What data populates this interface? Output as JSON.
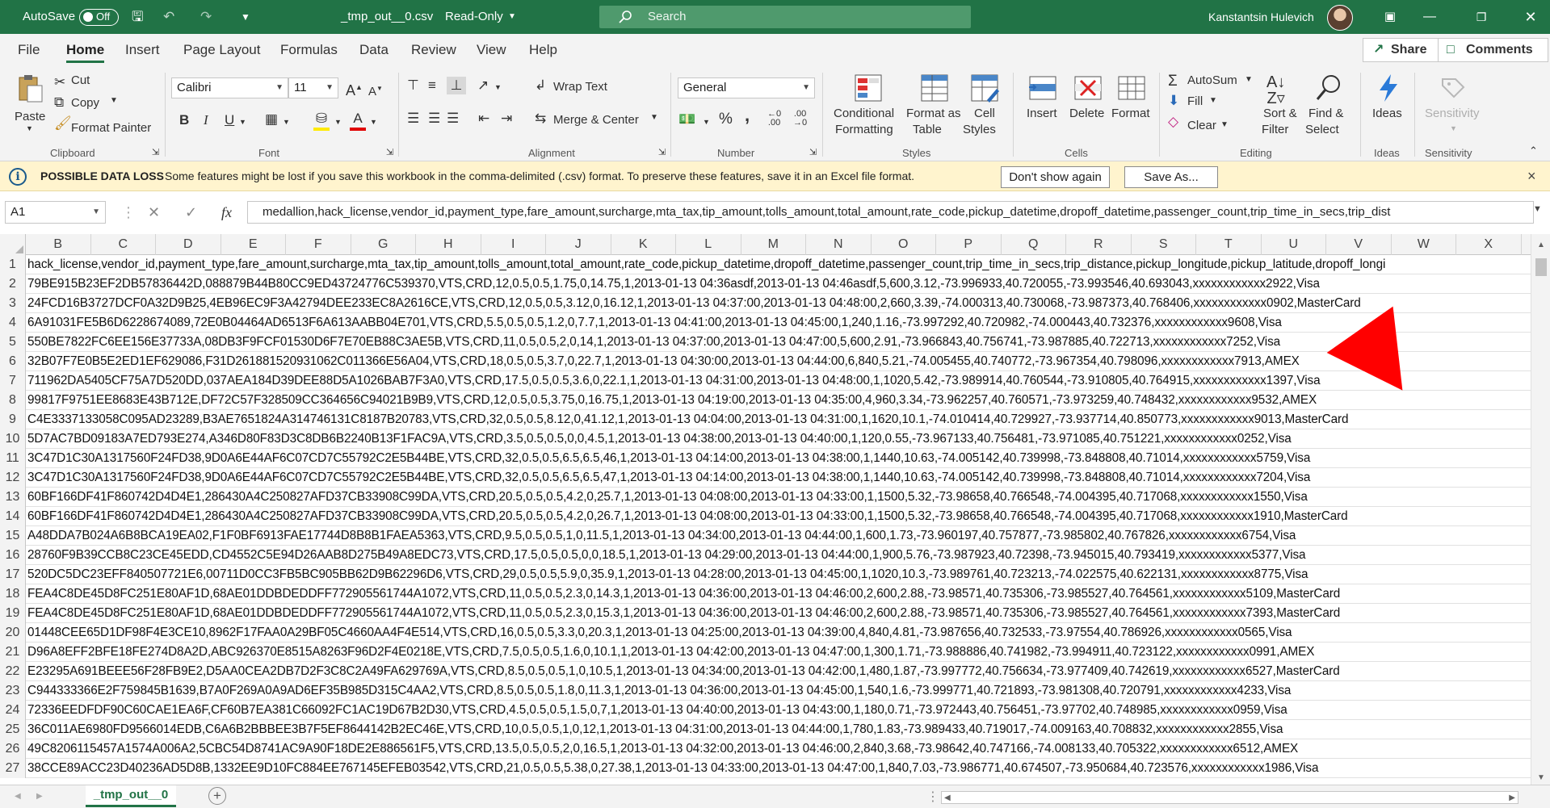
{
  "titlebar": {
    "autosave_label": "AutoSave",
    "autosave_state": "Off",
    "filename": "_tmp_out__0.csv",
    "mode": "Read-Only",
    "search_placeholder": "Search",
    "user_name": "Kanstantsin Hulevich",
    "accent": "#217346"
  },
  "tabs": [
    "File",
    "Home",
    "Insert",
    "Page Layout",
    "Formulas",
    "Data",
    "Review",
    "View",
    "Help"
  ],
  "active_tab": "Home",
  "share_label": "Share",
  "comments_label": "Comments",
  "ribbon": {
    "clipboard": {
      "paste": "Paste",
      "cut": "Cut",
      "copy": "Copy",
      "format_painter": "Format Painter",
      "group": "Clipboard"
    },
    "font": {
      "name": "Calibri",
      "size": "11",
      "group": "Font",
      "bold": "B",
      "italic": "I",
      "underline": "U"
    },
    "alignment": {
      "wrap": "Wrap Text",
      "merge": "Merge & Center",
      "group": "Alignment"
    },
    "number": {
      "format": "General",
      "percent": "%",
      "comma": ",",
      "group": "Number"
    },
    "styles": {
      "conditional": [
        "Conditional",
        "Formatting"
      ],
      "format_table": [
        "Format as",
        "Table"
      ],
      "cell_styles": [
        "Cell",
        "Styles"
      ],
      "group": "Styles"
    },
    "cells": {
      "insert": "Insert",
      "delete": "Delete",
      "format": "Format",
      "group": "Cells"
    },
    "editing": {
      "autosum": "AutoSum",
      "fill": "Fill",
      "clear": "Clear",
      "sort": [
        "Sort &",
        "Filter"
      ],
      "find": [
        "Find &",
        "Select"
      ],
      "group": "Editing"
    },
    "ideas": {
      "label": "Ideas",
      "group": "Ideas"
    },
    "sensitivity": {
      "label": "Sensitivity",
      "group": "Sensitivity"
    }
  },
  "infobar": {
    "title": "POSSIBLE DATA LOSS",
    "message": "Some features might be lost if you save this workbook in the comma-delimited (.csv) format. To preserve these features, save it in an Excel file format.",
    "dont_show": "Don't show again",
    "save_as": "Save As...",
    "close": "×"
  },
  "formula_bar": {
    "name_box": "A1",
    "fx": "fx",
    "content": "medallion,hack_license,vendor_id,payment_type,fare_amount,surcharge,mta_tax,tip_amount,tolls_amount,total_amount,rate_code,pickup_datetime,dropoff_datetime,passenger_count,trip_time_in_secs,trip_dist"
  },
  "columns": [
    "B",
    "C",
    "D",
    "E",
    "F",
    "G",
    "H",
    "I",
    "J",
    "K",
    "L",
    "M",
    "N",
    "O",
    "P",
    "Q",
    "R",
    "S",
    "T",
    "U",
    "V",
    "W",
    "X"
  ],
  "rows": [
    {
      "n": "1",
      "text": "hack_license,vendor_id,payment_type,fare_amount,surcharge,mta_tax,tip_amount,tolls_amount,total_amount,rate_code,pickup_datetime,dropoff_datetime,passenger_count,trip_time_in_secs,trip_distance,pickup_longitude,pickup_latitude,dropoff_longi"
    },
    {
      "n": "2",
      "text": "79BE915B23EF2DB57836442D,088879B44B80CC9ED43724776C539370,VTS,CRD,12,0.5,0.5,1.75,0,14.75,1,2013-01-13 04:36asdf,2013-01-13 04:46asdf,5,600,3.12,-73.996933,40.720055,-73.993546,40.693043,xxxxxxxxxxxx2922,Visa"
    },
    {
      "n": "3",
      "text": "24FCD16B3727DCF0A32D9B25,4EB96EC9F3A42794DEE233EC8A2616CE,VTS,CRD,12,0.5,0.5,3.12,0,16.12,1,2013-01-13 04:37:00,2013-01-13 04:48:00,2,660,3.39,-74.000313,40.730068,-73.987373,40.768406,xxxxxxxxxxxx0902,MasterCard"
    },
    {
      "n": "4",
      "text": "6A91031FE5B6D6228674089,72E0B04464AD6513F6A613AABB04E701,VTS,CRD,5.5,0.5,0.5,1.2,0,7.7,1,2013-01-13 04:41:00,2013-01-13 04:45:00,1,240,1.16,-73.997292,40.720982,-74.000443,40.732376,xxxxxxxxxxxx9608,Visa"
    },
    {
      "n": "5",
      "text": "550BE7822FC6EE156E37733A,08DB3F9FCF01530D6F7E70EB88C3AE5B,VTS,CRD,11,0.5,0.5,2,0,14,1,2013-01-13 04:37:00,2013-01-13 04:47:00,5,600,2.91,-73.966843,40.756741,-73.987885,40.722713,xxxxxxxxxxxx7252,Visa"
    },
    {
      "n": "6",
      "text": "32B07F7E0B5E2ED1EF629086,F31D261881520931062C011366E56A04,VTS,CRD,18,0.5,0.5,3.7,0,22.7,1,2013-01-13 04:30:00,2013-01-13 04:44:00,6,840,5.21,-74.005455,40.740772,-73.967354,40.798096,xxxxxxxxxxxx7913,AMEX"
    },
    {
      "n": "7",
      "text": "711962DA5405CF75A7D520DD,037AEA184D39DEE88D5A1026BAB7F3A0,VTS,CRD,17.5,0.5,0.5,3.6,0,22.1,1,2013-01-13 04:31:00,2013-01-13 04:48:00,1,1020,5.42,-73.989914,40.760544,-73.910805,40.764915,xxxxxxxxxxxx1397,Visa"
    },
    {
      "n": "8",
      "text": "99817F9751EE8683E43B712E,DF72C57F328509CC364656C94021B9B9,VTS,CRD,12,0.5,0.5,3.75,0,16.75,1,2013-01-13 04:19:00,2013-01-13 04:35:00,4,960,3.34,-73.962257,40.760571,-73.973259,40.748432,xxxxxxxxxxxx9532,AMEX"
    },
    {
      "n": "9",
      "text": "C4E3337133058C095AD23289,B3AE7651824A314746131C8187B20783,VTS,CRD,32,0.5,0.5,8.12,0,41.12,1,2013-01-13 04:04:00,2013-01-13 04:31:00,1,1620,10.1,-74.010414,40.729927,-73.937714,40.850773,xxxxxxxxxxxx9013,MasterCard"
    },
    {
      "n": "10",
      "text": "5D7AC7BD09183A7ED793E274,A346D80F83D3C8DB6B2240B13F1FAC9A,VTS,CRD,3.5,0.5,0.5,0,0,4.5,1,2013-01-13 04:38:00,2013-01-13 04:40:00,1,120,0.55,-73.967133,40.756481,-73.971085,40.751221,xxxxxxxxxxxx0252,Visa"
    },
    {
      "n": "11",
      "text": "3C47D1C30A1317560F24FD38,9D0A6E44AF6C07CD7C55792C2E5B44BE,VTS,CRD,32,0.5,0.5,6.5,6.5,46,1,2013-01-13 04:14:00,2013-01-13 04:38:00,1,1440,10.63,-74.005142,40.739998,-73.848808,40.71014,xxxxxxxxxxxx5759,Visa"
    },
    {
      "n": "12",
      "text": "3C47D1C30A1317560F24FD38,9D0A6E44AF6C07CD7C55792C2E5B44BE,VTS,CRD,32,0.5,0.5,6.5,6.5,47,1,2013-01-13 04:14:00,2013-01-13 04:38:00,1,1440,10.63,-74.005142,40.739998,-73.848808,40.71014,xxxxxxxxxxxx7204,Visa"
    },
    {
      "n": "13",
      "text": "60BF166DF41F860742D4D4E1,286430A4C250827AFD37CB33908C99DA,VTS,CRD,20.5,0.5,0.5,4.2,0,25.7,1,2013-01-13 04:08:00,2013-01-13 04:33:00,1,1500,5.32,-73.98658,40.766548,-74.004395,40.717068,xxxxxxxxxxxx1550,Visa"
    },
    {
      "n": "14",
      "text": "60BF166DF41F860742D4D4E1,286430A4C250827AFD37CB33908C99DA,VTS,CRD,20.5,0.5,0.5,4.2,0,26.7,1,2013-01-13 04:08:00,2013-01-13 04:33:00,1,1500,5.32,-73.98658,40.766548,-74.004395,40.717068,xxxxxxxxxxxx1910,MasterCard"
    },
    {
      "n": "15",
      "text": "A48DDA7B024A6B8BCA19EA02,F1F0BF6913FAE17744D8B8B1FAEA5363,VTS,CRD,9.5,0.5,0.5,1,0,11.5,1,2013-01-13 04:34:00,2013-01-13 04:44:00,1,600,1.73,-73.960197,40.757877,-73.985802,40.767826,xxxxxxxxxxxx6754,Visa"
    },
    {
      "n": "16",
      "text": "28760F9B39CCB8C23CE45EDD,CD4552C5E94D26AAB8D275B49A8EDC73,VTS,CRD,17.5,0.5,0.5,0,0,18.5,1,2013-01-13 04:29:00,2013-01-13 04:44:00,1,900,5.76,-73.987923,40.72398,-73.945015,40.793419,xxxxxxxxxxxx5377,Visa"
    },
    {
      "n": "17",
      "text": "520DC5DC23EFF840507721E6,00711D0CC3FB5BC905BB62D9B62296D6,VTS,CRD,29,0.5,0.5,5.9,0,35.9,1,2013-01-13 04:28:00,2013-01-13 04:45:00,1,1020,10.3,-73.989761,40.723213,-74.022575,40.622131,xxxxxxxxxxxx8775,Visa"
    },
    {
      "n": "18",
      "text": "FEA4C8DE45D8FC251E80AF1D,68AE01DDBDEDDFF772905561744A1072,VTS,CRD,11,0.5,0.5,2.3,0,14.3,1,2013-01-13 04:36:00,2013-01-13 04:46:00,2,600,2.88,-73.98571,40.735306,-73.985527,40.764561,xxxxxxxxxxxx5109,MasterCard"
    },
    {
      "n": "19",
      "text": "FEA4C8DE45D8FC251E80AF1D,68AE01DDBDEDDFF772905561744A1072,VTS,CRD,11,0.5,0.5,2.3,0,15.3,1,2013-01-13 04:36:00,2013-01-13 04:46:00,2,600,2.88,-73.98571,40.735306,-73.985527,40.764561,xxxxxxxxxxxx7393,MasterCard"
    },
    {
      "n": "20",
      "text": "01448CEE65D1DF98F4E3CE10,8962F17FAA0A29BF05C4660AA4F4E514,VTS,CRD,16,0.5,0.5,3.3,0,20.3,1,2013-01-13 04:25:00,2013-01-13 04:39:00,4,840,4.81,-73.987656,40.732533,-73.97554,40.786926,xxxxxxxxxxxx0565,Visa"
    },
    {
      "n": "21",
      "text": "D96A8EFF2BFE18FE274D8A2D,ABC926370E8515A8263F96D2F4E0218E,VTS,CRD,7.5,0.5,0.5,1.6,0,10.1,1,2013-01-13 04:42:00,2013-01-13 04:47:00,1,300,1.71,-73.988886,40.741982,-73.994911,40.723122,xxxxxxxxxxxx0991,AMEX"
    },
    {
      "n": "22",
      "text": "E23295A691BEEE56F28FB9E2,D5AA0CEA2DB7D2F3C8C2A49FA629769A,VTS,CRD,8.5,0.5,0.5,1,0,10.5,1,2013-01-13 04:34:00,2013-01-13 04:42:00,1,480,1.87,-73.997772,40.756634,-73.977409,40.742619,xxxxxxxxxxxx6527,MasterCard"
    },
    {
      "n": "23",
      "text": "C944333366E2F759845B1639,B7A0F269A0A9AD6EF35B985D315C4AA2,VTS,CRD,8.5,0.5,0.5,1.8,0,11.3,1,2013-01-13 04:36:00,2013-01-13 04:45:00,1,540,1.6,-73.999771,40.721893,-73.981308,40.720791,xxxxxxxxxxxx4233,Visa"
    },
    {
      "n": "24",
      "text": "72336EEDFDF90C60CAE1EA6F,CF60B7EA381C66092FC1AC19D67B2D30,VTS,CRD,4.5,0.5,0.5,1.5,0,7,1,2013-01-13 04:40:00,2013-01-13 04:43:00,1,180,0.71,-73.972443,40.756451,-73.97702,40.748985,xxxxxxxxxxxx0959,Visa"
    },
    {
      "n": "25",
      "text": "36C011AE6980FD9566014EDB,C6A6B2BBBEE3B7F5EF8644142B2EC46E,VTS,CRD,10,0.5,0.5,1,0,12,1,2013-01-13 04:31:00,2013-01-13 04:44:00,1,780,1.83,-73.989433,40.719017,-74.009163,40.708832,xxxxxxxxxxxx2855,Visa"
    },
    {
      "n": "26",
      "text": "49C8206115457A1574A006A2,5CBC54D8741AC9A90F18DE2E886561F5,VTS,CRD,13.5,0.5,0.5,2,0,16.5,1,2013-01-13 04:32:00,2013-01-13 04:46:00,2,840,3.68,-73.98642,40.747166,-74.008133,40.705322,xxxxxxxxxxxx6512,AMEX"
    },
    {
      "n": "27",
      "text": "38CCE89ACC23D40236AD5D8B,1332EE9D10FC884EE767145EFEB03542,VTS,CRD,21,0.5,0.5,5.38,0,27.38,1,2013-01-13 04:33:00,2013-01-13 04:47:00,1,840,7.03,-73.986771,40.674507,-73.950684,40.723576,xxxxxxxxxxxx1986,Visa"
    }
  ],
  "sheet_tab": "_tmp_out__0",
  "annotation_color": "#ff0000"
}
